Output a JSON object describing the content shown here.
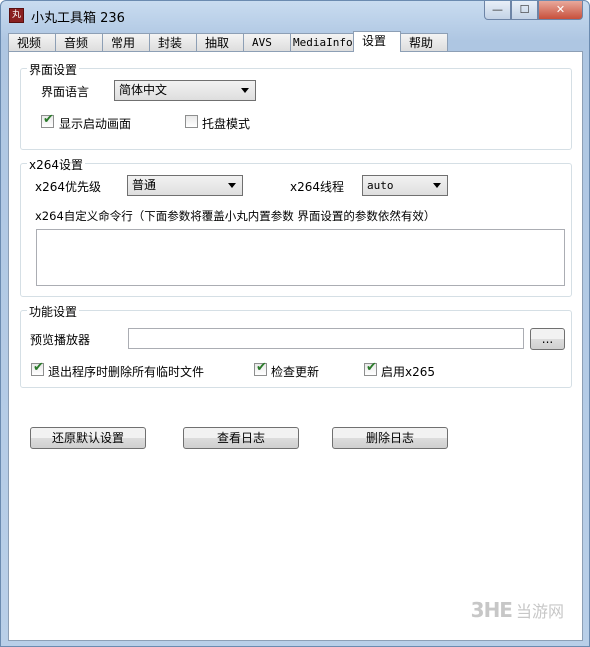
{
  "window": {
    "icon_text": "丸",
    "title": "小丸工具箱 236",
    "minimize_glyph": "—",
    "maximize_glyph": "☐",
    "close_glyph": "✕"
  },
  "tabs": [
    {
      "label": "视频"
    },
    {
      "label": "音频"
    },
    {
      "label": "常用"
    },
    {
      "label": "封装"
    },
    {
      "label": "抽取"
    },
    {
      "label": "AVS"
    },
    {
      "label": "MediaInfo"
    },
    {
      "label": "设置",
      "active": true
    },
    {
      "label": "帮助"
    }
  ],
  "ui_settings": {
    "legend": "界面设置",
    "language_label": "界面语言",
    "language_value": "简体中文",
    "show_splash_label": "显示启动画面",
    "show_splash_checked": true,
    "tray_mode_label": "托盘模式",
    "tray_mode_checked": false
  },
  "x264_settings": {
    "legend": "x264设置",
    "priority_label": "x264优先级",
    "priority_value": "普通",
    "threads_label": "x264线程",
    "threads_value": "auto",
    "custom_cmd_label": "x264自定义命令行（下面参数将覆盖小丸内置参数 界面设置的参数依然有效）",
    "custom_cmd_value": ""
  },
  "feature_settings": {
    "legend": "功能设置",
    "player_label": "预览播放器",
    "player_value": "",
    "browse_label": "...",
    "delete_temp_label": "退出程序时删除所有临时文件",
    "delete_temp_checked": true,
    "check_update_label": "检查更新",
    "check_update_checked": true,
    "enable_x265_label": "启用x265",
    "enable_x265_checked": true
  },
  "buttons": {
    "restore_defaults": "还原默认设置",
    "view_log": "查看日志",
    "delete_log": "删除日志"
  },
  "watermark": {
    "logo": "3HE",
    "text": "当游网"
  }
}
